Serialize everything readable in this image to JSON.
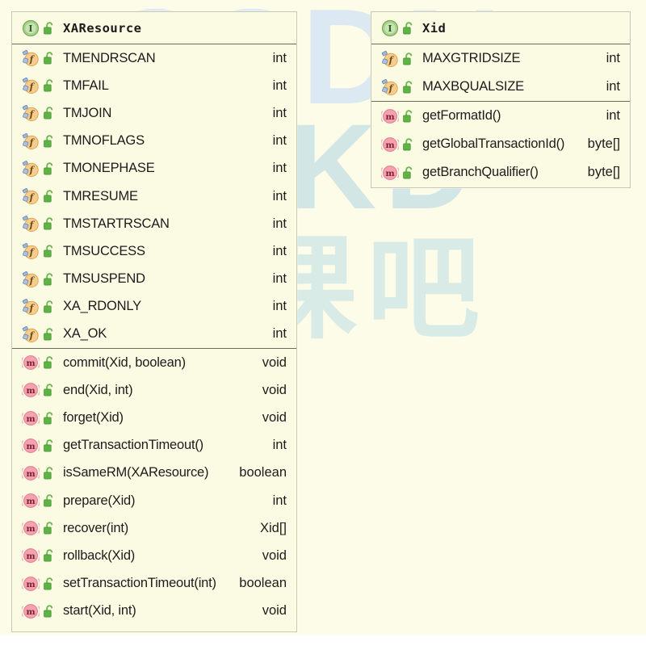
{
  "diagram": {
    "title": "UML class diagram",
    "background_color": "#fdfce9",
    "box_fill_color": "#fbfbe4",
    "box_border_color": "#c8c8b4",
    "watermark": {
      "line1": "CSDN",
      "line2": "@IKD",
      "line3": "开课吧"
    }
  },
  "classes": [
    {
      "id": "xaresource",
      "name": "XAResource",
      "stereotype_icon": "interface-icon",
      "visibility_icon": "unlock-icon",
      "fields": [
        {
          "icon": "static-field-icon",
          "lock": "unlock-icon",
          "name": "TMENDRSCAN",
          "type": "int"
        },
        {
          "icon": "static-field-icon",
          "lock": "unlock-icon",
          "name": "TMFAIL",
          "type": "int"
        },
        {
          "icon": "static-field-icon",
          "lock": "unlock-icon",
          "name": "TMJOIN",
          "type": "int"
        },
        {
          "icon": "static-field-icon",
          "lock": "unlock-icon",
          "name": "TMNOFLAGS",
          "type": "int"
        },
        {
          "icon": "static-field-icon",
          "lock": "unlock-icon",
          "name": "TMONEPHASE",
          "type": "int"
        },
        {
          "icon": "static-field-icon",
          "lock": "unlock-icon",
          "name": "TMRESUME",
          "type": "int"
        },
        {
          "icon": "static-field-icon",
          "lock": "unlock-icon",
          "name": "TMSTARTRSCAN",
          "type": "int"
        },
        {
          "icon": "static-field-icon",
          "lock": "unlock-icon",
          "name": "TMSUCCESS",
          "type": "int"
        },
        {
          "icon": "static-field-icon",
          "lock": "unlock-icon",
          "name": "TMSUSPEND",
          "type": "int"
        },
        {
          "icon": "static-field-icon",
          "lock": "unlock-icon",
          "name": "XA_RDONLY",
          "type": "int"
        },
        {
          "icon": "static-field-icon",
          "lock": "unlock-icon",
          "name": "XA_OK",
          "type": "int"
        }
      ],
      "methods": [
        {
          "icon": "method-icon",
          "lock": "unlock-icon",
          "name": "commit(Xid, boolean)",
          "type": "void"
        },
        {
          "icon": "method-icon",
          "lock": "unlock-icon",
          "name": "end(Xid, int)",
          "type": "void"
        },
        {
          "icon": "method-icon",
          "lock": "unlock-icon",
          "name": "forget(Xid)",
          "type": "void"
        },
        {
          "icon": "method-icon",
          "lock": "unlock-icon",
          "name": "getTransactionTimeout()",
          "type": "int"
        },
        {
          "icon": "method-icon",
          "lock": "unlock-icon",
          "name": "isSameRM(XAResource)",
          "type": "boolean"
        },
        {
          "icon": "method-icon",
          "lock": "unlock-icon",
          "name": "prepare(Xid)",
          "type": "int"
        },
        {
          "icon": "method-icon",
          "lock": "unlock-icon",
          "name": "recover(int)",
          "type": "Xid[]"
        },
        {
          "icon": "method-icon",
          "lock": "unlock-icon",
          "name": "rollback(Xid)",
          "type": "void"
        },
        {
          "icon": "method-icon",
          "lock": "unlock-icon",
          "name": "setTransactionTimeout(int)",
          "type": "boolean"
        },
        {
          "icon": "method-icon",
          "lock": "unlock-icon",
          "name": "start(Xid, int)",
          "type": "void"
        }
      ]
    },
    {
      "id": "xid",
      "name": "Xid",
      "stereotype_icon": "interface-icon",
      "visibility_icon": "unlock-icon",
      "fields": [
        {
          "icon": "static-field-icon",
          "lock": "unlock-icon",
          "name": "MAXGTRIDSIZE",
          "type": "int"
        },
        {
          "icon": "static-field-icon",
          "lock": "unlock-icon",
          "name": "MAXBQUALSIZE",
          "type": "int"
        }
      ],
      "methods": [
        {
          "icon": "method-icon",
          "lock": "unlock-icon",
          "name": "getFormatId()",
          "type": "int"
        },
        {
          "icon": "method-icon",
          "lock": "unlock-icon",
          "name": "getGlobalTransactionId()",
          "type": "byte[]"
        },
        {
          "icon": "method-icon",
          "lock": "unlock-icon",
          "name": "getBranchQualifier()",
          "type": "byte[]"
        }
      ]
    }
  ],
  "colors": {
    "interface_circle": "#8dc06a",
    "field_circle": "#f2c178",
    "method_circle": "#f08ca0",
    "lock_green": "#61b34a",
    "text": "#1c1c1c",
    "separator": "#6b6b5a"
  }
}
